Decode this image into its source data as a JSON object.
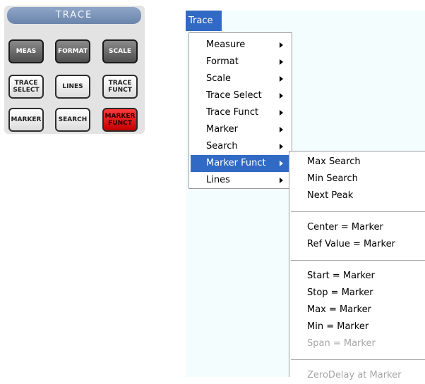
{
  "panel": {
    "title": "TRACE",
    "keys": [
      {
        "label": "MEAS"
      },
      {
        "label": "FORMAT"
      },
      {
        "label": "SCALE"
      },
      {
        "label": "TRACE\nSELECT"
      },
      {
        "label": "LINES"
      },
      {
        "label": "TRACE\nFUNCT"
      },
      {
        "label": "MARKER"
      },
      {
        "label": "SEARCH"
      },
      {
        "label": "MARKER\nFUNCT"
      }
    ],
    "highlight_color": "#e60000"
  },
  "menubar": {
    "trace_label": "Trace"
  },
  "menu": {
    "items": [
      {
        "label": "Measure"
      },
      {
        "label": "Format"
      },
      {
        "label": "Scale"
      },
      {
        "label": "Trace Select"
      },
      {
        "label": "Trace Funct"
      },
      {
        "label": "Marker"
      },
      {
        "label": "Search"
      },
      {
        "label": "Marker Funct"
      },
      {
        "label": "Lines"
      }
    ],
    "selected": "Marker Funct",
    "highlight_color": "#316ac5"
  },
  "submenu": {
    "items": [
      {
        "label": "Max Search"
      },
      {
        "label": "Min Search"
      },
      {
        "label": "Next Peak"
      },
      {
        "label": "Center = Marker"
      },
      {
        "label": "Ref Value = Marker"
      },
      {
        "label": "Start = Marker"
      },
      {
        "label": "Stop = Marker"
      },
      {
        "label": "Max = Marker"
      },
      {
        "label": "Min = Marker"
      },
      {
        "label": "Span = Marker",
        "disabled": true
      },
      {
        "label": "ZeroDelay at Marker",
        "disabled": true
      }
    ]
  }
}
